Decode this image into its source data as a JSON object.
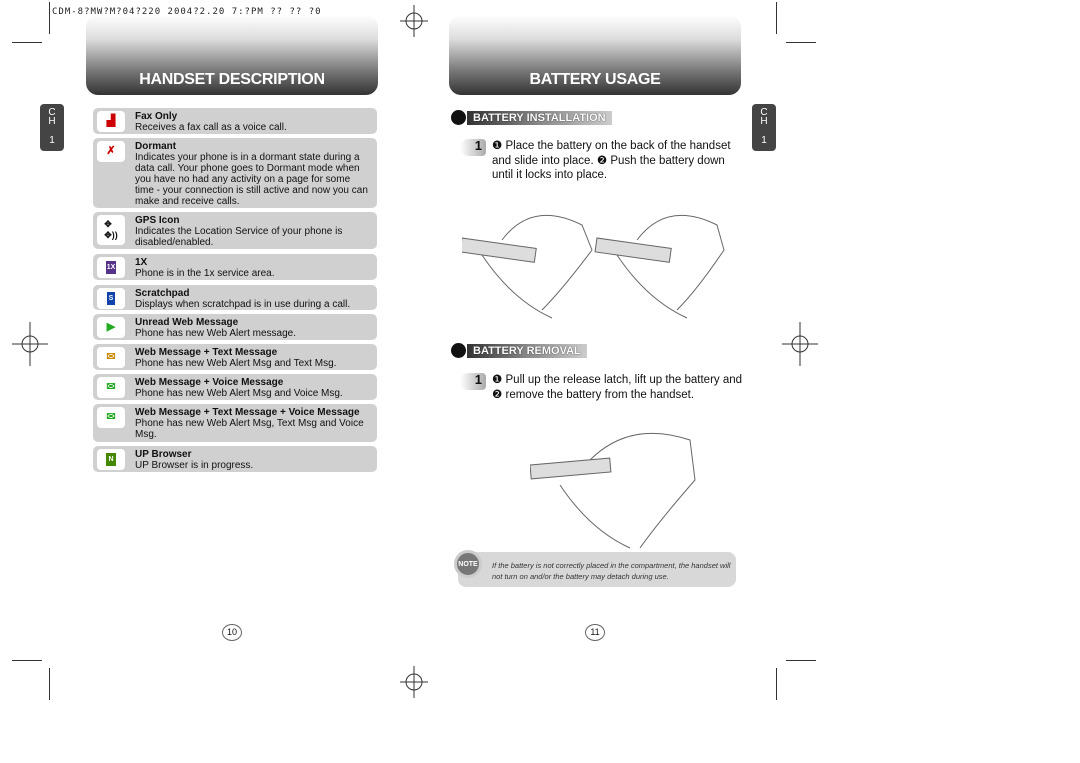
{
  "slug": "CDM-8?MW?M?04?220 2004?2.20 7:?PM ?? ?? ?0",
  "left": {
    "header": "HANDSET DESCRIPTION",
    "chapter": {
      "letters": "C H",
      "number": "1"
    },
    "items": [
      {
        "title": "Fax Only",
        "desc": "Receives a fax call as a voice call.",
        "icon": "fax-icon"
      },
      {
        "title": "Dormant",
        "desc": "Indicates your phone is in a dormant state during a data call.  Your phone goes to Dormant mode when you have no had any activity on a page for some time - your connection is still active and now you can make and receive calls.",
        "icon": "dormant-icon"
      },
      {
        "title": "GPS Icon",
        "desc": "Indicates the Location Service of your phone is disabled/enabled.",
        "icon": "gps-icon"
      },
      {
        "title": "1X",
        "desc": "Phone is in the 1x service area.",
        "icon": "1x-icon"
      },
      {
        "title": "Scratchpad",
        "desc": "Displays when scratchpad is in use during a call.",
        "icon": "scratchpad-icon"
      },
      {
        "title": "Unread Web Message",
        "desc": "Phone has new Web Alert message.",
        "icon": "web-message-flag-icon"
      },
      {
        "title": "Web Message + Text Message",
        "desc": "Phone has new Web Alert Msg and Text Msg.",
        "icon": "web-text-message-icon"
      },
      {
        "title": "Web Message + Voice Message",
        "desc": "Phone has new Web Alert Msg and Voice Msg.",
        "icon": "web-voice-message-icon"
      },
      {
        "title": "Web Message + Text Message + Voice Message",
        "desc": "Phone has new Web Alert Msg, Text Msg and Voice Msg.",
        "icon": "web-text-voice-message-icon"
      },
      {
        "title": "UP Browser",
        "desc": "UP Browser is in progress.",
        "icon": "up-browser-icon"
      }
    ],
    "page_number": "10"
  },
  "right": {
    "header": "BATTERY USAGE",
    "chapter": {
      "letters": "C H",
      "number": "1"
    },
    "installation": {
      "title": "BATTERY INSTALLATION",
      "step": "1",
      "text": "❶ Place the battery on the back of the handset and slide into place. ❷ Push the battery down until it locks into place."
    },
    "removal": {
      "title": "BATTERY REMOVAL",
      "step": "1",
      "text": "❶ Pull up the release latch, lift up the battery and ❷ remove the battery from the handset."
    },
    "note": {
      "icon_label": "NOTE",
      "text": "If the battery is not correctly placed in the compartment, the handset will not turn on and/or the battery may detach during use."
    },
    "page_number": "11"
  }
}
